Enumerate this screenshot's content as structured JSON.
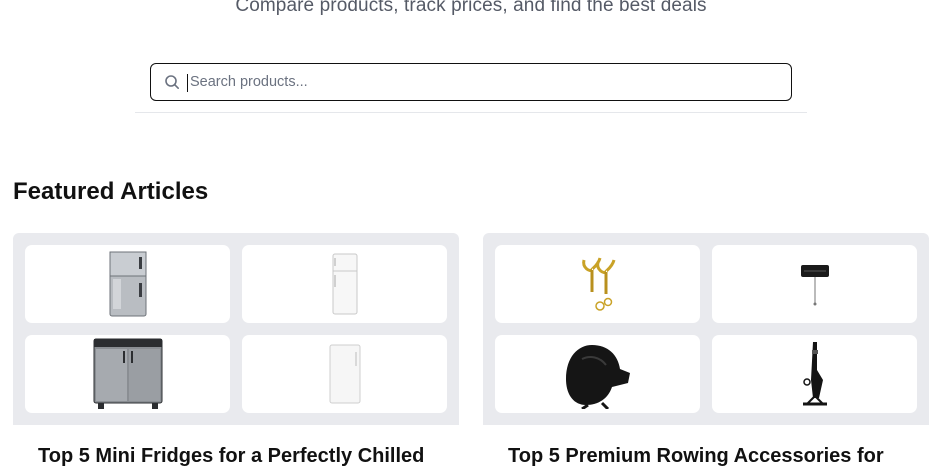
{
  "header": {
    "subtitle": "Compare products, track prices, and find the best deals"
  },
  "search": {
    "placeholder": "Search products...",
    "value": "",
    "icon": "search-icon"
  },
  "featured": {
    "title": "Featured Articles",
    "articles": [
      {
        "title": "Top 5 Mini Fridges for a Perfectly Chilled",
        "images": [
          "mini-fridge-silver-icon",
          "tall-white-fridge-icon",
          "stainless-mini-fridge-icon",
          "white-upright-freezer-icon"
        ]
      },
      {
        "title": "Top 5 Premium Rowing Accessories for",
        "images": [
          "brass-oarlocks-icon",
          "black-handle-icon",
          "black-rower-cover-icon",
          "upright-rower-stand-icon"
        ]
      }
    ]
  },
  "colors": {
    "card_bg": "#e9eaee",
    "subtitle_text": "#555a66",
    "border": "#111111"
  }
}
